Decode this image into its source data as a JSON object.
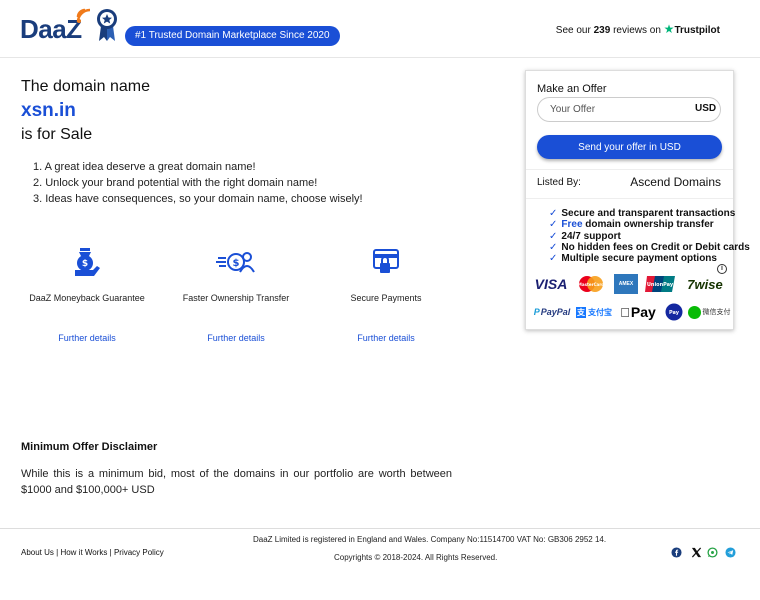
{
  "header": {
    "logo_text": "DaaZ",
    "tagline": "#1 Trusted Domain Marketplace Since 2020",
    "trust_prefix": "See our",
    "trust_count": "239",
    "trust_suffix": "reviews on",
    "trust_brand": "Trustpilot"
  },
  "hero": {
    "line1": "The domain name",
    "domain": "xsn.in",
    "line3": "is for Sale"
  },
  "ideas": [
    "1. A great idea deserve a great domain name!",
    "2. Unlock your brand potential with the right domain name!",
    "3. Ideas have consequences, so your domain name, choose wisely!"
  ],
  "features": [
    {
      "icon": "moneyback-icon",
      "title": "DaaZ Moneyback Guarantee",
      "link": "Further details"
    },
    {
      "icon": "transfer-icon",
      "title": "Faster Ownership Transfer",
      "link": "Further details"
    },
    {
      "icon": "secure-payment-icon",
      "title": "Secure Payments",
      "link": "Further details"
    }
  ],
  "disclaimer": {
    "title": "Minimum Offer Disclaimer",
    "text": "While this is a minimum bid, most of the domains in our portfolio are worth between $1000 and $100,000+ USD"
  },
  "offer": {
    "title": "Make an Offer",
    "placeholder": "Your Offer",
    "currency": "USD",
    "button": "Send your offer in USD",
    "listed_label": "Listed By:",
    "listed_value": "Ascend Domains"
  },
  "benefits": [
    {
      "check": "✓",
      "highlight": "",
      "text": "Secure and transparent transactions"
    },
    {
      "check": "✓",
      "highlight": "Free",
      "text": " domain ownership transfer"
    },
    {
      "check": "✓",
      "highlight": "",
      "text": "24/7 support"
    },
    {
      "check": "✓",
      "highlight": "",
      "text": "No hidden fees on Credit or Debit cards"
    },
    {
      "check": "✓",
      "highlight": "",
      "text": "Multiple secure payment options"
    }
  ],
  "payment_methods": {
    "visa": "VISA",
    "mastercard": "MasterCard",
    "amex": "AMEX",
    "unionpay": "UnionPay",
    "wise": "7wise",
    "paypal": "PayPal",
    "alipay": "支付宝",
    "applepay": "Pay",
    "samsungpay": "Pay",
    "wechat": "微信支付"
  },
  "footer": {
    "link_about": "About Us",
    "link_how": "How it Works",
    "link_privacy": "Privacy Policy",
    "separator": " | ",
    "company": "DaaZ Limited is registered in England and Wales. Company No:11514700   VAT No: GB306 2952 14.",
    "copyright": "Copyrights © 2018-2024. All Rights Reserved."
  },
  "colors": {
    "brand_blue": "#1a4fd6",
    "logo_navy": "#1a3d7c",
    "trustpilot_green": "#00b67a"
  }
}
